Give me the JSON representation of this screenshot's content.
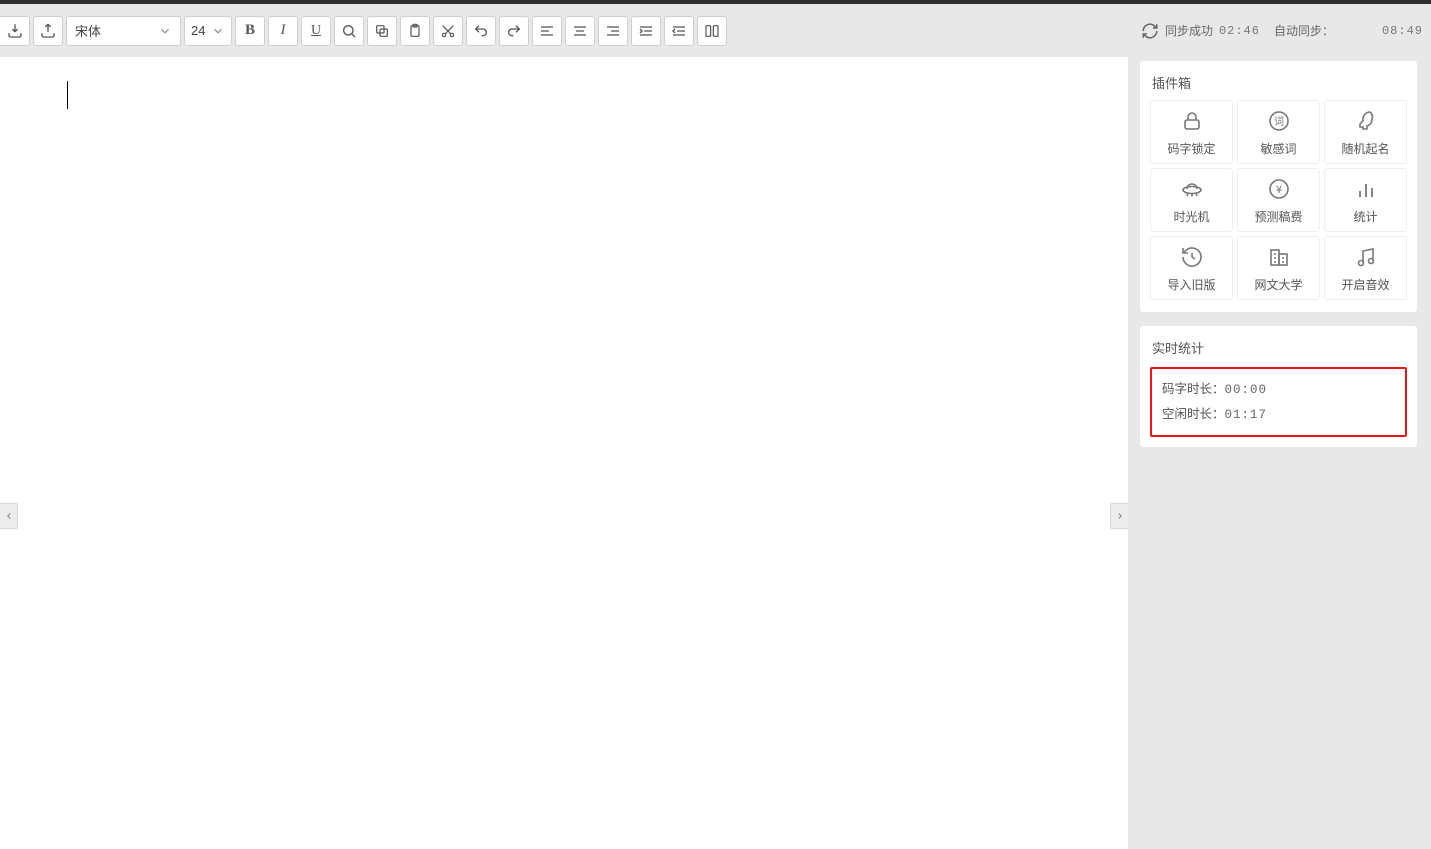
{
  "toolbar": {
    "font_name": "宋体",
    "font_size": "24"
  },
  "sync": {
    "status_label": "同步成功",
    "status_time": "02:46",
    "auto_label": "自动同步：",
    "clock": "08:49"
  },
  "sidebar": {
    "plugins_title": "插件箱",
    "plugins": [
      {
        "label": "码字锁定"
      },
      {
        "label": "敏感词"
      },
      {
        "label": "随机起名"
      },
      {
        "label": "时光机"
      },
      {
        "label": "预测稿费"
      },
      {
        "label": "统计"
      },
      {
        "label": "导入旧版"
      },
      {
        "label": "网文大学"
      },
      {
        "label": "开启音效"
      }
    ],
    "stats_title": "实时统计",
    "stats": {
      "typing_label": "码字时长：",
      "typing_value": "00:00",
      "idle_label": "空闲时长：",
      "idle_value": "01:17"
    }
  }
}
